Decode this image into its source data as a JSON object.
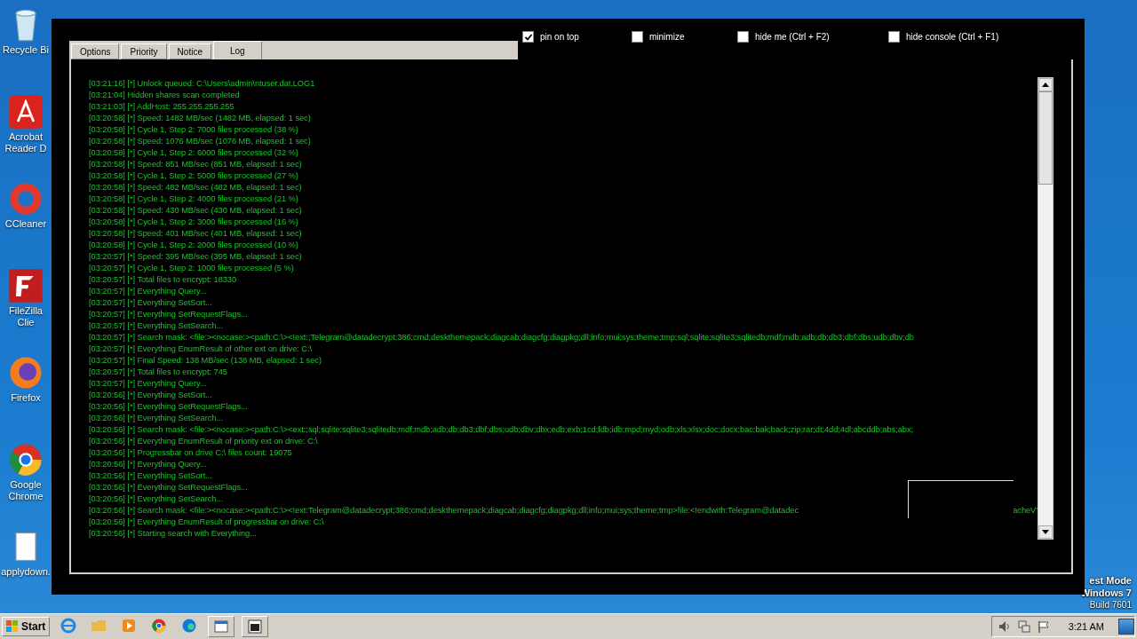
{
  "desktop_icons": [
    {
      "kind": "recycle",
      "label": "Recycle Bi"
    },
    {
      "kind": "acrobat",
      "label": "Acrobat Reader D"
    },
    {
      "kind": "ccleaner",
      "label": "CCleaner"
    },
    {
      "kind": "filezilla",
      "label": "FileZilla Clie"
    },
    {
      "kind": "firefox",
      "label": "Firefox"
    },
    {
      "kind": "chrome",
      "label": "Google Chrome"
    },
    {
      "kind": "file",
      "label": "applydown."
    }
  ],
  "window": {
    "tabs": [
      {
        "label": "Options",
        "selected": false
      },
      {
        "label": "Priority",
        "selected": false
      },
      {
        "label": "Notice",
        "selected": false
      },
      {
        "label": "Log",
        "selected": true
      }
    ],
    "options": [
      {
        "label": "pin on top",
        "checked": true
      },
      {
        "label": "minimize",
        "checked": false
      },
      {
        "label": "hide me (Ctrl + F2)",
        "checked": false
      },
      {
        "label": "hide console (Ctrl + F1)",
        "checked": false
      }
    ],
    "log": [
      {
        "text": "[03:21:16] [*] Unlock queued: C:\\Users\\admin\\ntuser.dat.LOG1"
      },
      {
        "text": "[03:21:04] Hidden shares scan completed"
      },
      {
        "text": "[03:21:03] [*] AddHost: 255.255.255.255"
      },
      {
        "text": "[03:20:58] [*] Speed: 1482 MB/sec (1482 MB, elapsed: 1 sec)"
      },
      {
        "text": "[03:20:58] [*] Cycle 1, Step 2: 7000 files processed (38 %)"
      },
      {
        "text": "[03:20:58] [*] Speed: 1076 MB/sec (1076 MB, elapsed: 1 sec)"
      },
      {
        "text": "[03:20:58] [*] Cycle 1, Step 2: 6000 files processed (32 %)"
      },
      {
        "text": "[03:20:58] [*] Speed: 851 MB/sec (851 MB, elapsed: 1 sec)"
      },
      {
        "text": "[03:20:58] [*] Cycle 1, Step 2: 5000 files processed (27 %)"
      },
      {
        "text": "[03:20:58] [*] Speed: 482 MB/sec (482 MB, elapsed: 1 sec)"
      },
      {
        "text": "[03:20:58] [*] Cycle 1, Step 2: 4000 files processed (21 %)"
      },
      {
        "text": "[03:20:58] [*] Speed: 430 MB/sec (430 MB, elapsed: 1 sec)"
      },
      {
        "text": "[03:20:58] [*] Cycle 1, Step 2: 3000 files processed (16 %)"
      },
      {
        "text": "[03:20:58] [*] Speed: 401 MB/sec (401 MB, elapsed: 1 sec)"
      },
      {
        "text": "[03:20:58] [*] Cycle 1, Step 2: 2000 files processed (10 %)"
      },
      {
        "text": "[03:20:57] [*] Speed: 395 MB/sec (395 MB, elapsed: 1 sec)"
      },
      {
        "text": "[03:20:57] [*] Cycle 1, Step 2: 1000 files processed (5 %)"
      },
      {
        "text": "[03:20:57] [*] Total files to encrypt: 18330"
      },
      {
        "text": "[03:20:57] [*] Everything Query..."
      },
      {
        "text": "[03:20:57] [*] Everything SetSort..."
      },
      {
        "text": "[03:20:57] [*] Everything SetRequestFlags..."
      },
      {
        "text": "[03:20:57] [*] Everything SetSearch..."
      },
      {
        "text": "[03:20:57] [*] Search mask: <file:><nocase:><path:C:\\><!ext:;Telegram@datadecrypt;386;cmd;deskthemepack;diagcab;diagcfg;diagpkg;dll;info;mui;sys;theme;tmp;sql;sqlite;sqlite3;sqlitedb;mdf;mdb;adb;db;db3;dbf;dbs;udb;dbv;db"
      },
      {
        "text": "[03:20:57] [*] Everything EnumResult of other ext on drive: C:\\"
      },
      {
        "text": "[03:20:57] [*] Final Speed: 138 MB/sec (138 MB, elapsed: 1 sec)"
      },
      {
        "text": "[03:20:57] [*] Total files to encrypt: 745"
      },
      {
        "text": "[03:20:57] [*] Everything Query..."
      },
      {
        "text": "[03:20:56] [*] Everything SetSort..."
      },
      {
        "text": "[03:20:56] [*] Everything SetRequestFlags..."
      },
      {
        "text": "[03:20:56] [*] Everything SetSearch..."
      },
      {
        "text": "[03:20:56] [*] Search mask: <file:><nocase:><path:C:\\><ext:;sql;sqlite;sqlite3;sqlitedb;mdf;mdb;adb;db;db3;dbf;dbs;udb;dbv;dbx;edb;exb;1cd;fdb;idb;mpd;myd;odb;xls;xlsx;doc;docx;bac;bak;back;zip;rar;dt;4dd;4dl;abcddb;abs;abx;"
      },
      {
        "text": "[03:20:56] [*] Everything EnumResult of priority ext on drive: C:\\"
      },
      {
        "text": "[03:20:56] [*] Progressbar on drive C:\\ files count: 19075"
      },
      {
        "text": "[03:20:56] [*] Everything Query..."
      },
      {
        "text": "[03:20:56] [*] Everything SetSort..."
      },
      {
        "text": "[03:20:56] [*] Everything SetRequestFlags..."
      },
      {
        "text": "[03:20:56] [*] Everything SetSearch..."
      },
      {
        "text": "[03:20:56] [*] Search mask: <file:><nocase:><path:C:\\><!ext:Telegram@datadecrypt;386;cmd;deskthemepack;diagcab;diagcfg;diagpkg;dll;info;mui;sys;theme;tmp>file:<!endwith:Telegram@datadec",
        "tail": "acheV'"
      },
      {
        "text": "[03:20:56] [*] Everything EnumResult of progressbar on drive: C:\\"
      },
      {
        "text": "[03:20:56] [*] Starting search with Everything..."
      }
    ]
  },
  "desktop_text": [
    "est Mode",
    "Windows 7",
    "Build 7601"
  ],
  "taskbar": {
    "start": "Start",
    "apps": [
      {
        "kind": "ie"
      },
      {
        "kind": "folder"
      },
      {
        "kind": "media"
      },
      {
        "kind": "chrome"
      },
      {
        "kind": "edge"
      },
      {
        "kind": "window"
      },
      {
        "kind": "console"
      }
    ],
    "clock": "3:21 AM"
  }
}
